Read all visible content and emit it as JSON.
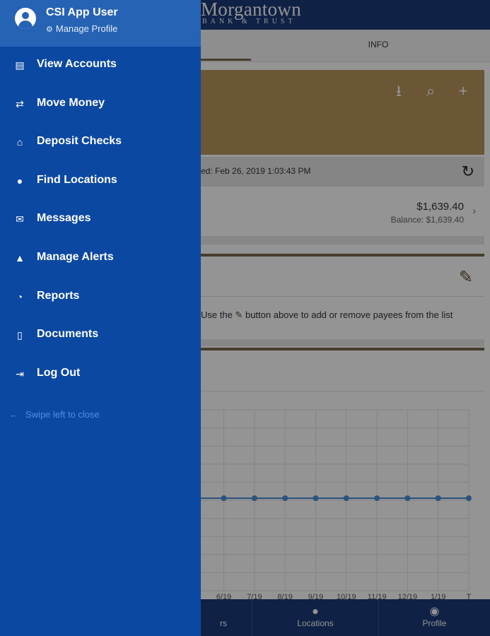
{
  "background": {
    "logo_name": "Morgantown",
    "logo_sub": "BANK & TRUST",
    "tab_info": "INFO",
    "account_actions": [
      "download-icon",
      "search-icon",
      "add-icon"
    ],
    "updated_text": "ed: Feb 26, 2019 1:03:43 PM",
    "balance_amount": "$1,639.40",
    "balance_sub": "Balance: $1,639.40",
    "payee_note_pre": "Use the",
    "payee_note_post": "button above to add or remove payees from the list",
    "chart_x_labels": [
      "6/19",
      "7/19",
      "8/19",
      "9/19",
      "10/19",
      "11/19",
      "12/19",
      "1/19",
      "T"
    ],
    "bottom_nav": {
      "partial_label": "rs",
      "locations_label": "Locations",
      "profile_label": "Profile"
    }
  },
  "drawer": {
    "user_name": "CSI App User",
    "manage_profile": "Manage Profile",
    "items": [
      {
        "label": "View Accounts",
        "icon": "accounts-icon"
      },
      {
        "label": "Move Money",
        "icon": "transfer-icon"
      },
      {
        "label": "Deposit Checks",
        "icon": "bank-icon"
      },
      {
        "label": "Find Locations",
        "icon": "location-pin-icon"
      },
      {
        "label": "Messages",
        "icon": "envelope-icon"
      },
      {
        "label": "Manage Alerts",
        "icon": "bell-icon"
      },
      {
        "label": "Reports",
        "icon": "pie-chart-icon"
      },
      {
        "label": "Documents",
        "icon": "document-icon"
      },
      {
        "label": "Log Out",
        "icon": "logout-icon"
      }
    ],
    "swipe_hint": "Swipe left to close"
  },
  "colors": {
    "drawer_bg": "#0b48a1",
    "drawer_header_bg": "#2763b4",
    "header_bg": "#1b3a78",
    "account_card": "#b8965e",
    "accent_gold": "#7a6a4c",
    "chart_line": "#4a90d9"
  }
}
